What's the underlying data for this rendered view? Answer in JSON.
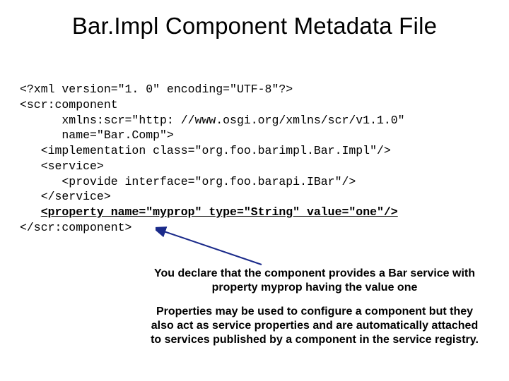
{
  "title": "Bar.Impl Component Metadata File",
  "code": {
    "l1": "<?xml version=\"1. 0\" encoding=\"UTF-8\"?>",
    "l2": "<scr:component",
    "l3": "      xmlns:scr=\"http: //www.osgi.org/xmlns/scr/v1.1.0\"",
    "l4": "      name=\"Bar.Comp\">",
    "l5": "   <implementation class=\"org.foo.barimpl.Bar.Impl\"/>",
    "l6": "   <service>",
    "l7": "      <provide interface=\"org.foo.barapi.IBar\"/>",
    "l8": "   </service>",
    "l9a": "   ",
    "l9b": "<property name=\"myprop\" type=\"String\" value=\"one\"/>",
    "l10": "</scr:component>"
  },
  "note1": "You declare that the component provides a Bar service with property myprop  having the value one",
  "note2": "Properties may be used to configure a component but they also act as service properties and are automatically attached to services published by a component in the service registry."
}
